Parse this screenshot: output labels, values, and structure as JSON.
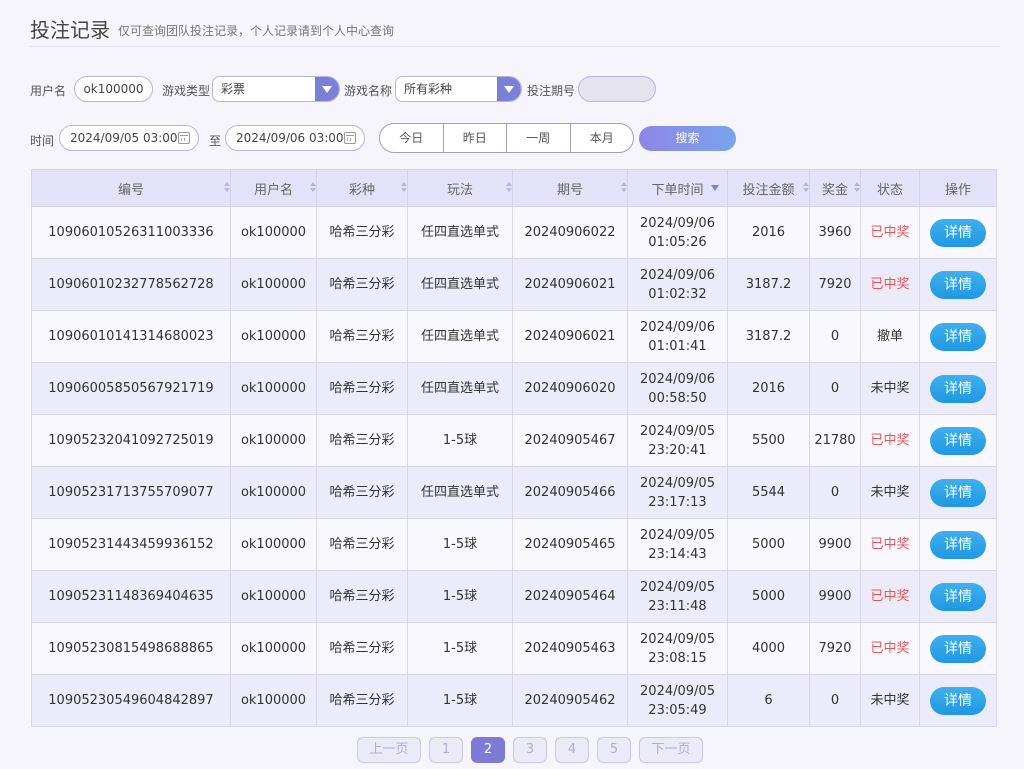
{
  "header": {
    "title": "投注记录",
    "subtitle": "仅可查询团队投注记录，个人记录请到个人中心查询"
  },
  "filters": {
    "username_label": "用户名",
    "username_value": "ok100000",
    "game_type_label": "游戏类型",
    "game_type_value": "彩票",
    "game_name_label": "游戏名称",
    "game_name_value": "所有彩种",
    "issue_label": "投注期号",
    "issue_value": "",
    "time_label": "时间",
    "time_start": "2024/09/05 03:00",
    "to_label": "至",
    "time_end": "2024/09/06 03:00",
    "quick": [
      "今日",
      "昨日",
      "一周",
      "本月"
    ],
    "search_label": "搜索"
  },
  "table": {
    "headers": [
      "编号",
      "用户名",
      "彩种",
      "玩法",
      "期号",
      "下单时间",
      "投注金额",
      "奖金",
      "状态",
      "操作"
    ],
    "rows": [
      {
        "id": "10906010526311003336",
        "user": "ok100000",
        "lottery": "哈希三分彩",
        "play": "任四直选单式",
        "issue": "20240906022",
        "date": "2024/09/06",
        "time": "01:05:26",
        "amount": "2016",
        "prize": "3960",
        "status": "已中奖",
        "win": true,
        "action": "详情"
      },
      {
        "id": "10906010232778562728",
        "user": "ok100000",
        "lottery": "哈希三分彩",
        "play": "任四直选单式",
        "issue": "20240906021",
        "date": "2024/09/06",
        "time": "01:02:32",
        "amount": "3187.2",
        "prize": "7920",
        "status": "已中奖",
        "win": true,
        "action": "详情"
      },
      {
        "id": "10906010141314680023",
        "user": "ok100000",
        "lottery": "哈希三分彩",
        "play": "任四直选单式",
        "issue": "20240906021",
        "date": "2024/09/06",
        "time": "01:01:41",
        "amount": "3187.2",
        "prize": "0",
        "status": "撤单",
        "win": false,
        "action": "详情"
      },
      {
        "id": "10906005850567921719",
        "user": "ok100000",
        "lottery": "哈希三分彩",
        "play": "任四直选单式",
        "issue": "20240906020",
        "date": "2024/09/06",
        "time": "00:58:50",
        "amount": "2016",
        "prize": "0",
        "status": "未中奖",
        "win": false,
        "action": "详情"
      },
      {
        "id": "10905232041092725019",
        "user": "ok100000",
        "lottery": "哈希三分彩",
        "play": "1-5球",
        "issue": "20240905467",
        "date": "2024/09/05",
        "time": "23:20:41",
        "amount": "5500",
        "prize": "21780",
        "status": "已中奖",
        "win": true,
        "action": "详情"
      },
      {
        "id": "10905231713755709077",
        "user": "ok100000",
        "lottery": "哈希三分彩",
        "play": "任四直选单式",
        "issue": "20240905466",
        "date": "2024/09/05",
        "time": "23:17:13",
        "amount": "5544",
        "prize": "0",
        "status": "未中奖",
        "win": false,
        "action": "详情"
      },
      {
        "id": "10905231443459936152",
        "user": "ok100000",
        "lottery": "哈希三分彩",
        "play": "1-5球",
        "issue": "20240905465",
        "date": "2024/09/05",
        "time": "23:14:43",
        "amount": "5000",
        "prize": "9900",
        "status": "已中奖",
        "win": true,
        "action": "详情"
      },
      {
        "id": "10905231148369404635",
        "user": "ok100000",
        "lottery": "哈希三分彩",
        "play": "1-5球",
        "issue": "20240905464",
        "date": "2024/09/05",
        "time": "23:11:48",
        "amount": "5000",
        "prize": "9900",
        "status": "已中奖",
        "win": true,
        "action": "详情"
      },
      {
        "id": "10905230815498688865",
        "user": "ok100000",
        "lottery": "哈希三分彩",
        "play": "1-5球",
        "issue": "20240905463",
        "date": "2024/09/05",
        "time": "23:08:15",
        "amount": "4000",
        "prize": "7920",
        "status": "已中奖",
        "win": true,
        "action": "详情"
      },
      {
        "id": "10905230549604842897",
        "user": "ok100000",
        "lottery": "哈希三分彩",
        "play": "1-5球",
        "issue": "20240905462",
        "date": "2024/09/05",
        "time": "23:05:49",
        "amount": "6",
        "prize": "0",
        "status": "未中奖",
        "win": false,
        "action": "详情"
      }
    ]
  },
  "pager": {
    "prev": "上一页",
    "pages": [
      "1",
      "2",
      "3",
      "4",
      "5"
    ],
    "current": "2",
    "next": "下一页"
  },
  "colors": {
    "accent": "#7c7fd8",
    "win": "#e85757",
    "detail_button": "#1f97e3"
  }
}
